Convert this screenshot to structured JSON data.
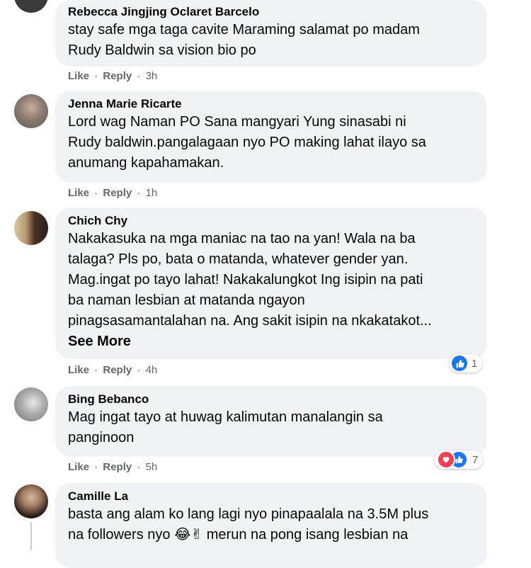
{
  "comments": [
    {
      "author": "Rebecca Jingjing Oclaret Barcelo",
      "lines": [
        "stay safe mga taga cavite Maraming salamat po madam",
        "Rudy Baldwin sa vision bio po"
      ],
      "like": "Like",
      "reply": "Reply",
      "time": "3h"
    },
    {
      "author": "Jenna Marie Ricarte",
      "lines": [
        "Lord wag Naman PO Sana mangyari Yung sinasabi ni",
        "Rudy baldwin.pangalagaan nyo PO making lahat ilayo sa",
        "anumang kapahamakan."
      ],
      "like": "Like",
      "reply": "Reply",
      "time": "1h"
    },
    {
      "author": "Chich Chy",
      "lines": [
        "Nakakasuka na mga maniac na tao na yan! Wala na ba",
        "talaga? Pls po, bata o matanda, whatever gender yan.",
        "Mag.ingat po tayo lahat! Nakakalungkot Ing isipin na pati",
        "ba naman lesbian at matanda ngayon",
        "pinagsasamantalahan na. Ang sakit isipin na nkakatakot..."
      ],
      "see_more": "See More",
      "like": "Like",
      "reply": "Reply",
      "time": "4h",
      "reaction_count": "1"
    },
    {
      "author": "Bing Bebanco",
      "lines": [
        "Mag ingat tayo at huwag kalimutan manalangin sa",
        "panginoon"
      ],
      "like": "Like",
      "reply": "Reply",
      "time": "5h",
      "reaction_count": "7"
    },
    {
      "author": "Camille La",
      "lines": [
        "basta ang alam ko lang lagi nyo pinapaalala na 3.5M plus",
        "na followers nyo 😂✌ merun na pong isang lesbian na"
      ]
    }
  ],
  "separator": "·",
  "colors": {
    "bubble": "#f0f2f5",
    "like_blue": "#1877f2",
    "love_red": "#f33e58"
  },
  "icons": {
    "like": "thumbs-up-icon",
    "love": "heart-icon"
  }
}
